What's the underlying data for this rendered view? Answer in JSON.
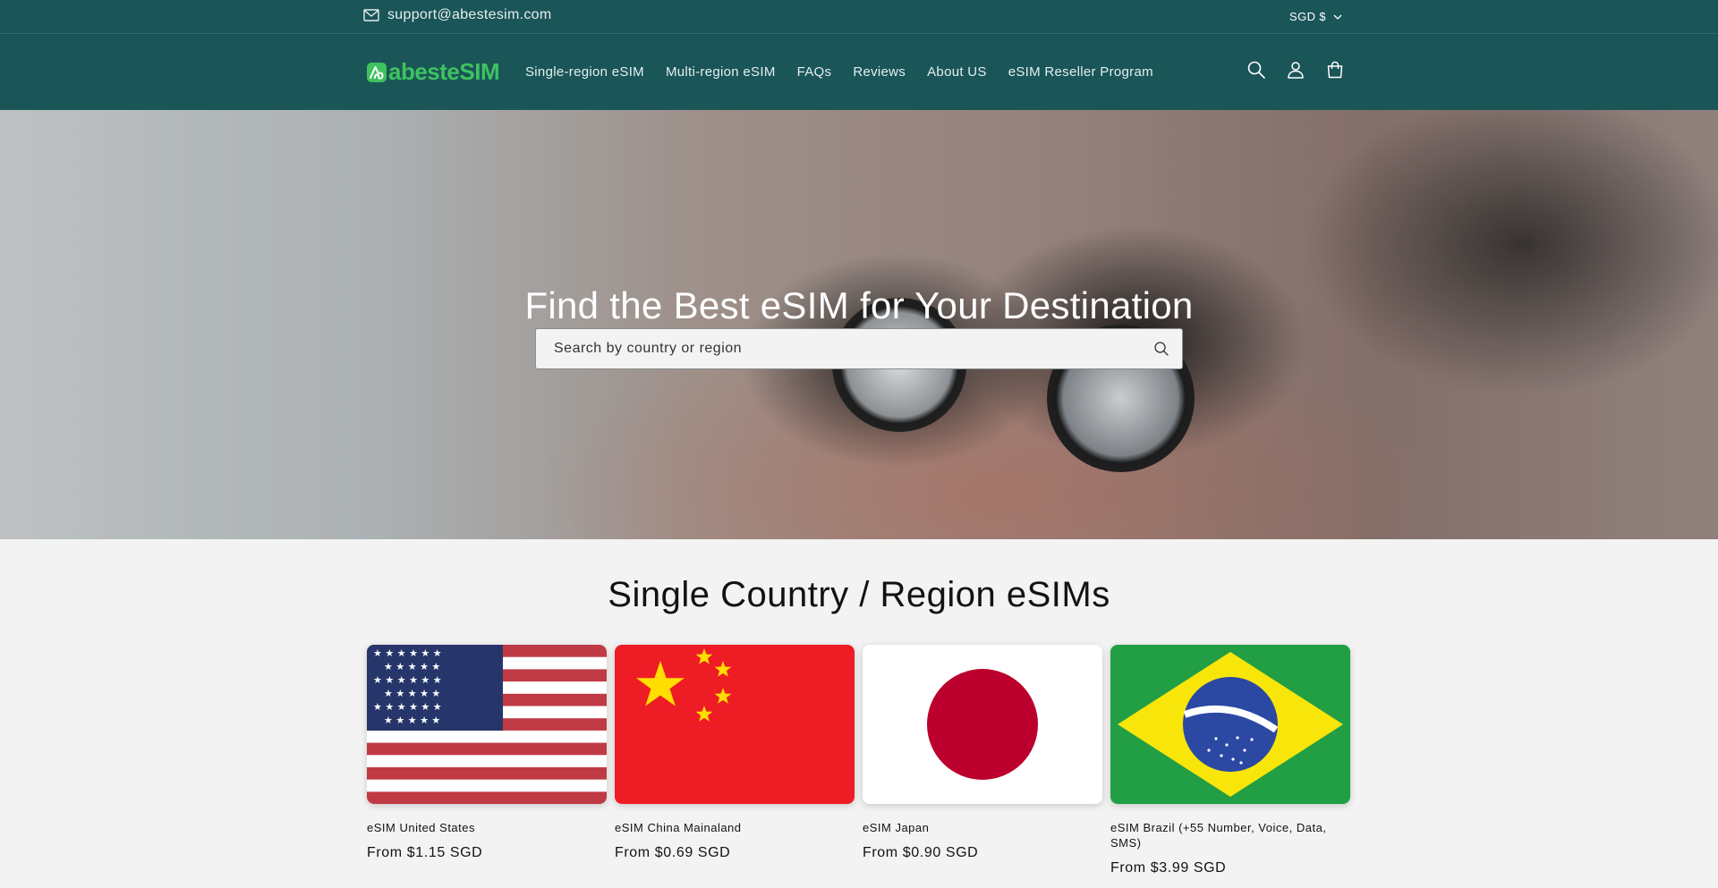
{
  "topbar": {
    "email": "support@abestesim.com",
    "currency": "SGD $"
  },
  "header": {
    "logo_text": "abesteSIM",
    "nav": [
      "Single-region eSIM",
      "Multi-region eSIM",
      "FAQs",
      "Reviews",
      "About US",
      "eSIM Reseller Program"
    ]
  },
  "hero": {
    "title": "Find the Best eSIM for Your Destination",
    "search_placeholder": "Search by country or region"
  },
  "section": {
    "title": "Single Country / Region eSIMs",
    "products": [
      {
        "title": "eSIM United States",
        "price": "From $1.15 SGD",
        "flag": "us-flag"
      },
      {
        "title": "eSIM China Mainaland",
        "price": "From $0.69 SGD",
        "flag": "china-flag"
      },
      {
        "title": "eSIM Japan",
        "price": "From $0.90 SGD",
        "flag": "japan-flag"
      },
      {
        "title": "eSIM Brazil (+55 Number, Voice, Data, SMS)",
        "price": "From $3.99 SGD",
        "flag": "brazil-flag"
      }
    ]
  },
  "colors": {
    "header_bg": "#1a5558",
    "brand_green": "#3ec25f",
    "page_bg": "#f3f3f3"
  }
}
